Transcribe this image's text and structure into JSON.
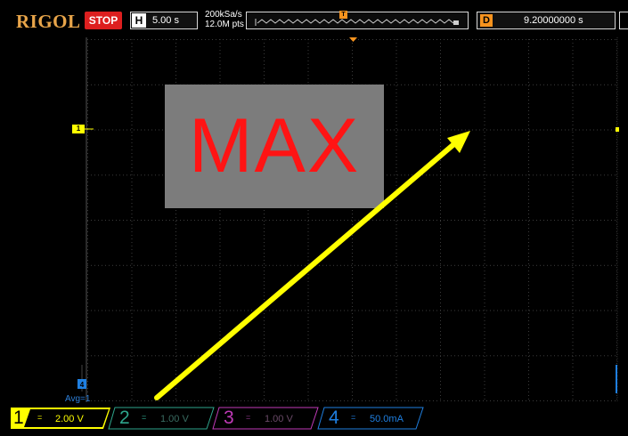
{
  "brand": "RIGOL",
  "top": {
    "run_state": "STOP",
    "h_label": "H",
    "h_value": "5.00 s",
    "sample_rate": "200kSa/s",
    "memory_depth": "12.0M pts",
    "trigger_marker": "T",
    "d_label": "D",
    "d_value": "9.20000000 s"
  },
  "overlay": {
    "text": "MAX"
  },
  "markers": {
    "ch1": "1",
    "ch4": "4"
  },
  "avg": "Avg=1",
  "channels": [
    {
      "num": "1",
      "scale": "2.00 V",
      "color": "#ffff00",
      "active": true
    },
    {
      "num": "2",
      "scale": "1.00 V",
      "color": "#2ea58c",
      "active": false
    },
    {
      "num": "3",
      "scale": "1.00 V",
      "color": "#c03ab8",
      "active": false
    },
    {
      "num": "4",
      "scale": "50.0mA",
      "color": "#1f7fe0",
      "active": false
    }
  ],
  "coupling_symbol": "=",
  "colors": {
    "ch1": "#ffff00",
    "ch2": "#2ea58c",
    "ch3": "#c03ab8",
    "ch4": "#1f7fe0",
    "stop": "#dd1f1f",
    "logo": "#e8a54a",
    "overlay_bg": "#7c7c7c",
    "overlay_text": "#ff1414",
    "arrow": "#ffff00"
  }
}
